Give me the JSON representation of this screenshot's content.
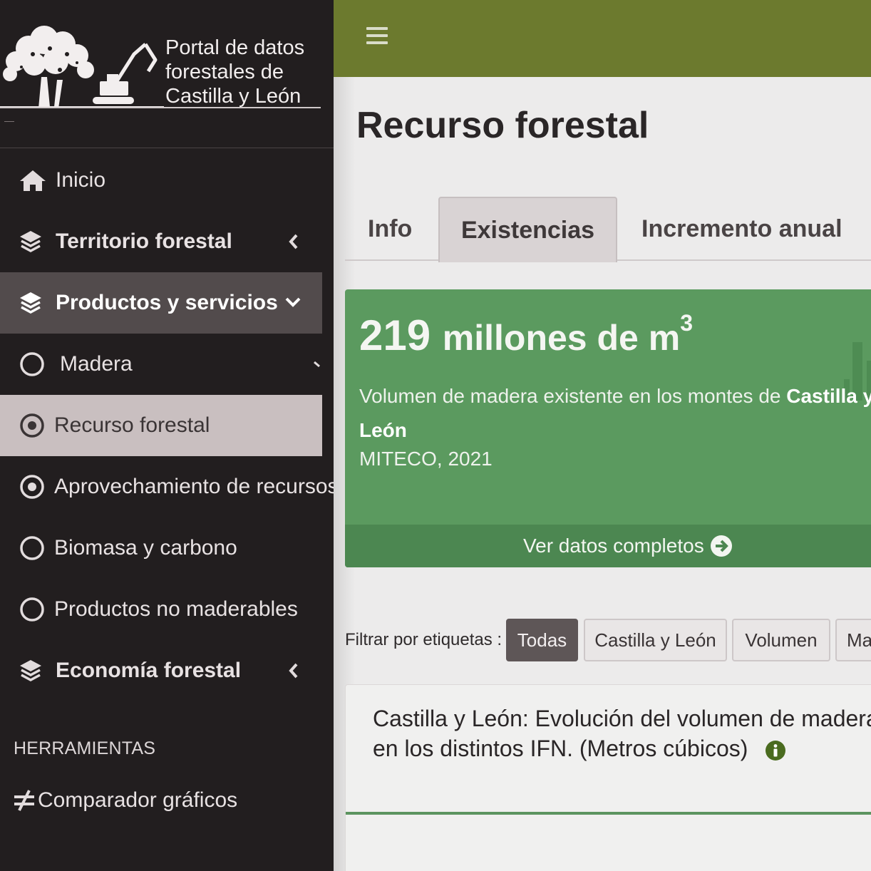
{
  "brand": {
    "lines": [
      "Portal de datos",
      "forestales de",
      "Castilla y León"
    ]
  },
  "sidebar": {
    "items": [
      {
        "label": "Inicio",
        "icon": "home-icon"
      },
      {
        "label": "Territorio forestal",
        "icon": "layers-icon"
      },
      {
        "label": "Productos y servicios",
        "icon": "layers-icon"
      },
      {
        "label": "Madera",
        "icon": "circle-icon"
      },
      {
        "label": "Recurso forestal",
        "icon": "dot-circle-icon"
      },
      {
        "label": "Aprovechamiento de recursos",
        "icon": "dot-circle-icon"
      },
      {
        "label": "Biomasa y carbono",
        "icon": "circle-icon"
      },
      {
        "label": "Productos no maderables",
        "icon": "circle-icon"
      },
      {
        "label": "Economía forestal",
        "icon": "layers-icon"
      }
    ],
    "tools_header": "HERRAMIENTAS",
    "tools_item": "Comparador gráficos"
  },
  "page": {
    "title": "Recurso forestal"
  },
  "tabs": [
    "Info",
    "Existencias",
    "Incremento anual"
  ],
  "card": {
    "value_number": "219",
    "value_unit": "millones de m",
    "value_exp": "3",
    "desc_prefix": "Volumen de madera existente en los montes de ",
    "desc_bold": "Castilla y León",
    "source": "MITECO, 2021",
    "footer_link": "Ver datos completos"
  },
  "filters": {
    "label": "Filtrar por etiquetas :",
    "chips": [
      "Todas",
      "Castilla y León",
      "Volumen",
      "Ma"
    ]
  },
  "chart_card": {
    "title": "Castilla y León: Evolución del volumen de madera en los distintos IFN. (Metros cúbicos)"
  },
  "colors": {
    "sidebar_bg": "#221e1f",
    "topbar": "#6c7a2e",
    "card_green": "#5b9a5f",
    "active_item": "#c9bfc0"
  }
}
